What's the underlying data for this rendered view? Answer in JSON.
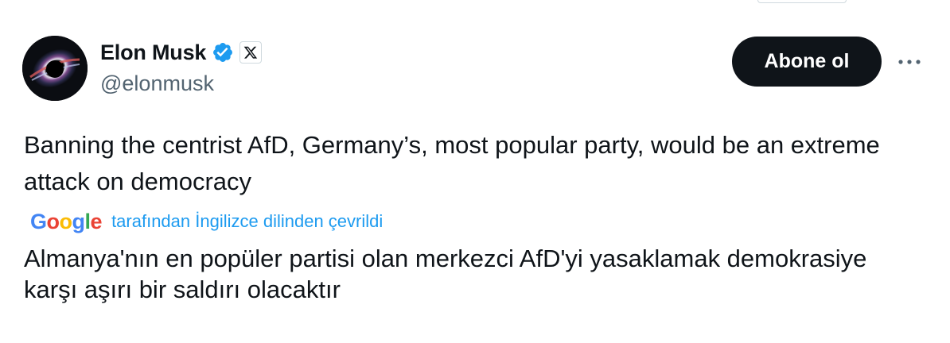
{
  "author": {
    "display_name": "Elon Musk",
    "handle": "@elonmusk",
    "avatar_icon": "black-hole-avatar",
    "verified_icon": "verified-badge-icon",
    "affiliation_icon": "x-logo-icon"
  },
  "actions": {
    "follow_label": "Abone ol",
    "more_icon": "more-icon"
  },
  "tweet": {
    "text": "Banning the centrist AfD, Germany’s, most popular party, would be an extreme attack on democracy"
  },
  "translation": {
    "provider_logo": [
      "G",
      "o",
      "o",
      "g",
      "l",
      "e"
    ],
    "note": "tarafından İngilizce dilinden çevrildi",
    "text": "Almanya'nın en popüler partisi olan merkezci AfD'yi yasaklamak demokrasiye karşı aşırı bir saldırı olacaktır"
  },
  "colors": {
    "text": "#0f1419",
    "secondary": "#536471",
    "link": "#1d9bf0",
    "verified": "#1d9bf0",
    "button_bg": "#0f1419",
    "google_blue": "#4285F4",
    "google_red": "#EA4335",
    "google_yellow": "#FBBC05",
    "google_green": "#34A853"
  }
}
